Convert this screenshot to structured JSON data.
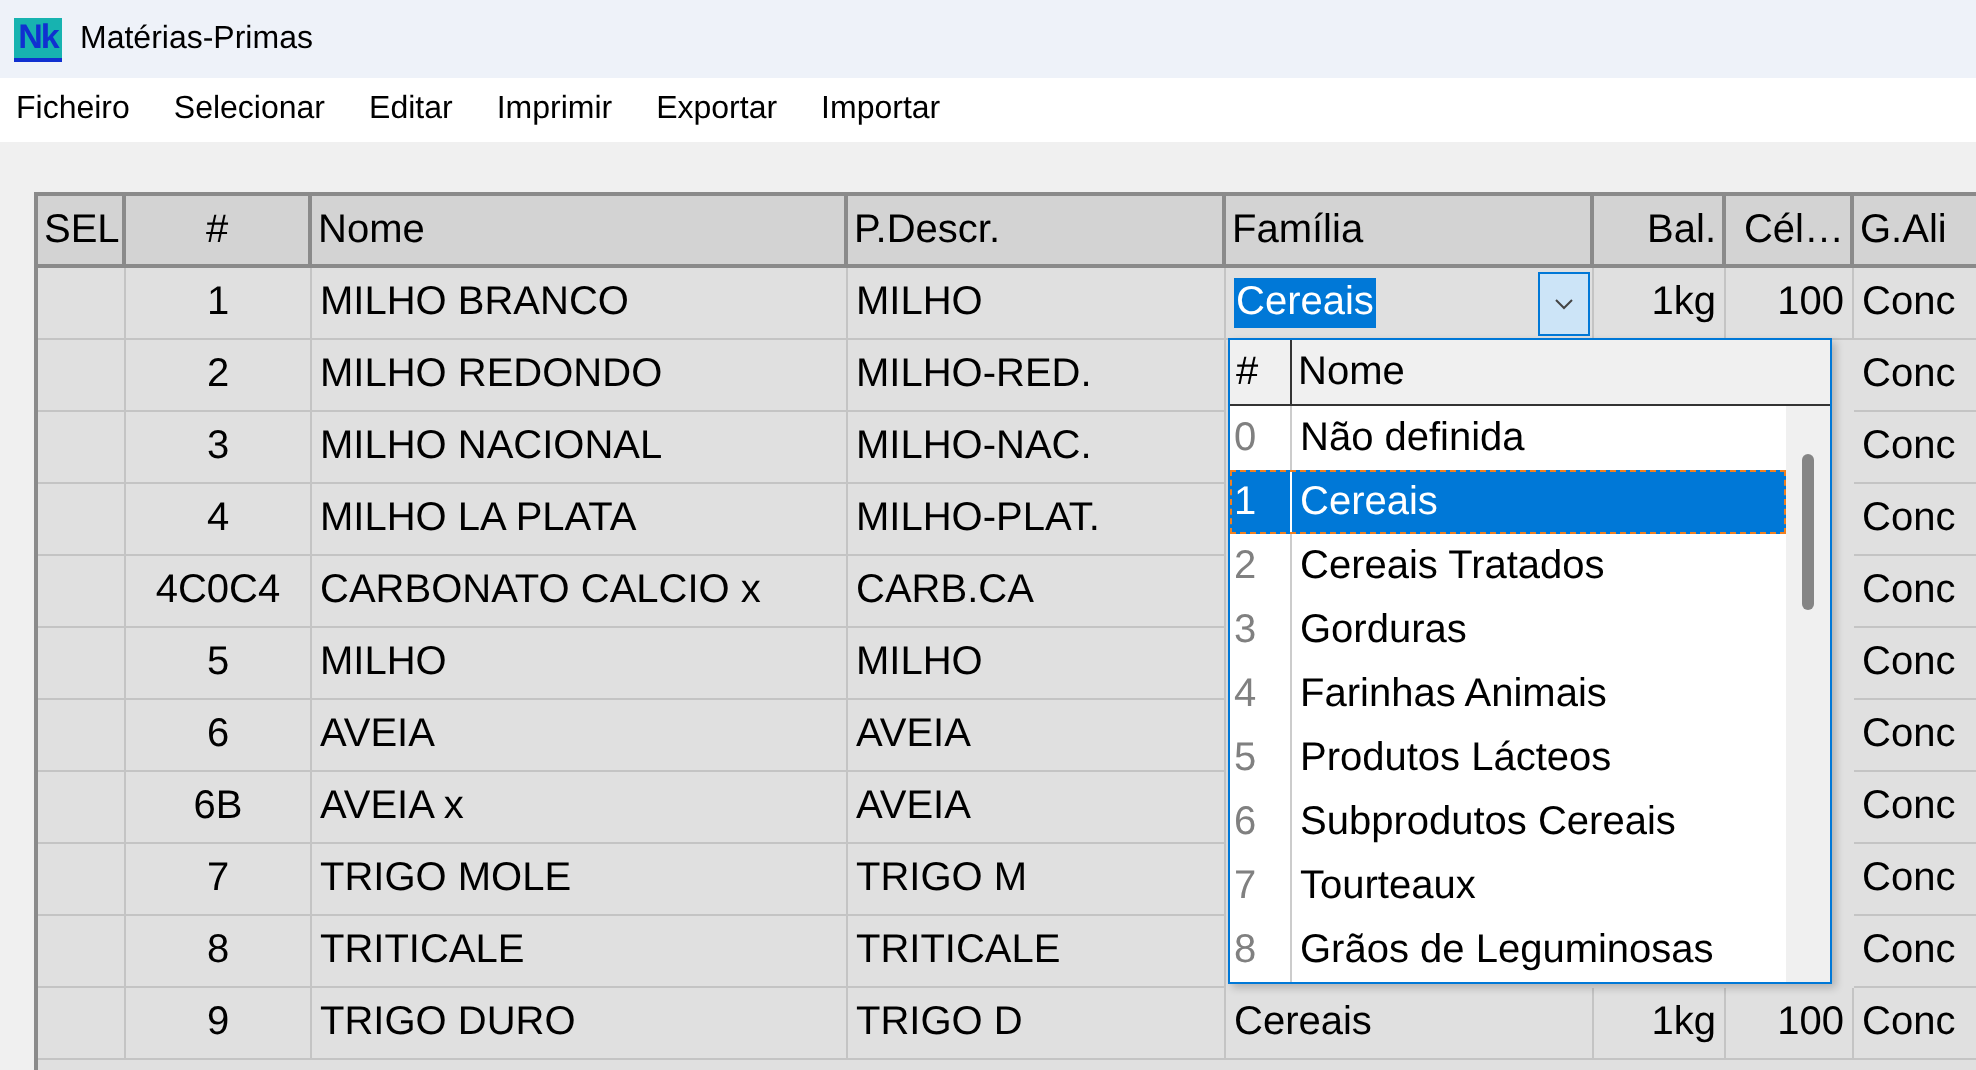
{
  "window": {
    "logo": "Nk",
    "title": "Matérias-Primas"
  },
  "menu": [
    "Ficheiro",
    "Selecionar",
    "Editar",
    "Imprimir",
    "Exportar",
    "Importar"
  ],
  "table": {
    "columns": [
      "SEL",
      "#",
      "Nome",
      "P.Descr.",
      "Família",
      "Bal.",
      "Cél…",
      "G.Ali"
    ],
    "rows": [
      {
        "id": "1",
        "nome": "MILHO BRANCO",
        "pdescr": "MILHO",
        "familia": "Cereais",
        "editing": true,
        "bal": "1kg",
        "cel": "100",
        "galim": "Conc"
      },
      {
        "id": "2",
        "nome": "MILHO REDONDO",
        "pdescr": "MILHO-RED.",
        "editing": false,
        "galim": "Conc"
      },
      {
        "id": "3",
        "nome": "MILHO NACIONAL",
        "pdescr": "MILHO-NAC.",
        "editing": false,
        "galim": "Conc"
      },
      {
        "id": "4",
        "nome": "MILHO LA PLATA",
        "pdescr": "MILHO-PLAT.",
        "editing": false,
        "galim": "Conc"
      },
      {
        "id": "4C0C4",
        "nome": "CARBONATO CALCIO x",
        "pdescr": "CARB.CA",
        "editing": false,
        "galim": "Conc"
      },
      {
        "id": "5",
        "nome": "MILHO",
        "pdescr": "MILHO",
        "editing": false,
        "galim": "Conc"
      },
      {
        "id": "6",
        "nome": "AVEIA",
        "pdescr": "AVEIA",
        "editing": false,
        "galim": "Conc"
      },
      {
        "id": "6B",
        "nome": "AVEIA x",
        "pdescr": "AVEIA",
        "editing": false,
        "galim": "Conc"
      },
      {
        "id": "7",
        "nome": "TRIGO MOLE",
        "pdescr": "TRIGO M",
        "editing": false,
        "galim": "Conc"
      },
      {
        "id": "8",
        "nome": "TRITICALE",
        "pdescr": "TRITICALE",
        "editing": false,
        "galim": "Conc"
      },
      {
        "id": "9",
        "nome": "TRIGO DURO",
        "pdescr": "TRIGO D",
        "familia": "Cereais",
        "editing": false,
        "bal": "1kg",
        "cel": "100",
        "galim": "Conc"
      }
    ]
  },
  "family_dropdown": {
    "columns": [
      "#",
      "Nome"
    ],
    "items": [
      {
        "number": "0",
        "name": "Não definida",
        "selected": false
      },
      {
        "number": "1",
        "name": "Cereais",
        "selected": true
      },
      {
        "number": "2",
        "name": "Cereais Tratados",
        "selected": false
      },
      {
        "number": "3",
        "name": "Gorduras",
        "selected": false
      },
      {
        "number": "4",
        "name": "Farinhas Animais",
        "selected": false
      },
      {
        "number": "5",
        "name": "Produtos Lácteos",
        "selected": false
      },
      {
        "number": "6",
        "name": "Subprodutos Cereais",
        "selected": false
      },
      {
        "number": "7",
        "name": "Tourteaux",
        "selected": false
      },
      {
        "number": "8",
        "name": "Grãos de Leguminosas",
        "selected": false
      }
    ]
  }
}
